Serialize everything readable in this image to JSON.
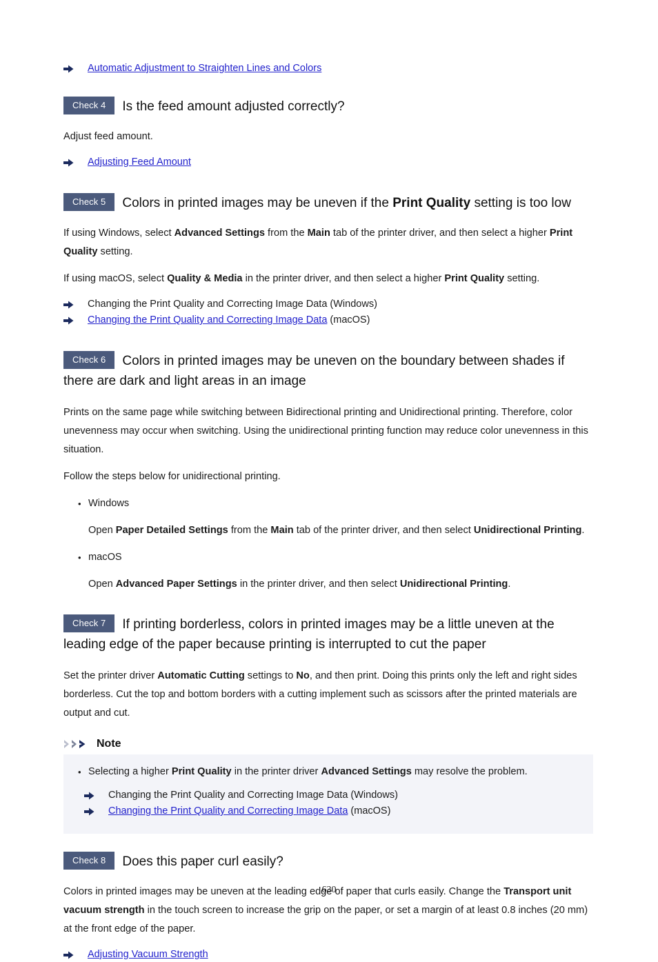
{
  "page": {
    "number": "630",
    "accent_badge_color": "#4b5a7c",
    "link_color": "#2222cc",
    "note_background_color": "#f3f4f9",
    "arrow_icon_color": "#1b2a5e"
  },
  "top_link": {
    "icon": "arrow-right-icon",
    "text": "Automatic Adjustment to Straighten Lines and Colors"
  },
  "check4": {
    "badge": "Check 4",
    "title": "Is the feed amount adjusted correctly?",
    "body": "Adjust feed amount.",
    "link": "Adjusting Feed Amount"
  },
  "check5": {
    "badge": "Check 5",
    "title_pre": "Colors in printed images may be uneven if the ",
    "title_bold": "Print Quality",
    "title_post": " setting is too low",
    "para1": [
      {
        "t": "If using Windows, select ",
        "b": false
      },
      {
        "t": "Advanced Settings",
        "b": true
      },
      {
        "t": " from the ",
        "b": false
      },
      {
        "t": "Main",
        "b": true
      },
      {
        "t": " tab of the printer driver, and then select a higher ",
        "b": false
      },
      {
        "t": "Print Quality",
        "b": true
      },
      {
        "t": " setting.",
        "b": false
      }
    ],
    "para2": [
      {
        "t": "If using macOS, select ",
        "b": false
      },
      {
        "t": "Quality & Media",
        "b": true
      },
      {
        "t": " in the printer driver, and then select a higher ",
        "b": false
      },
      {
        "t": "Print Quality",
        "b": true
      },
      {
        "t": " setting.",
        "b": false
      }
    ],
    "link_windows": "Changing the Print Quality and Correcting Image Data (Windows)",
    "link_macos_text": "Changing the Print Quality and Correcting Image Data",
    "link_macos_suffix": " (macOS)"
  },
  "check6": {
    "badge": "Check 6",
    "title": "Colors in printed images may be uneven on the boundary between shades if there are dark and light areas in an image",
    "para1": "Prints on the same page while switching between Bidirectional printing and Unidirectional printing. Therefore, color unevenness may occur when switching. Using the unidirectional printing function may reduce color unevenness in this situation.",
    "para2": "Follow the steps below for unidirectional printing.",
    "bullet_windows": "Windows",
    "windows_steps": [
      {
        "t": "Open ",
        "b": false
      },
      {
        "t": "Paper Detailed Settings",
        "b": true
      },
      {
        "t": " from the ",
        "b": false
      },
      {
        "t": "Main",
        "b": true
      },
      {
        "t": " tab of the printer driver, and then select ",
        "b": false
      },
      {
        "t": "Unidirectional Printing",
        "b": true
      },
      {
        "t": ".",
        "b": false
      }
    ],
    "bullet_macos": "macOS",
    "macos_steps": [
      {
        "t": "Open ",
        "b": false
      },
      {
        "t": "Advanced Paper Settings",
        "b": true
      },
      {
        "t": " in the printer driver, and then select ",
        "b": false
      },
      {
        "t": "Unidirectional Printing",
        "b": true
      },
      {
        "t": ".",
        "b": false
      }
    ]
  },
  "check7": {
    "badge": "Check 7",
    "title": "If printing borderless, colors in printed images may be a little uneven at the leading edge of the paper because printing is interrupted to cut the paper",
    "para1": [
      {
        "t": "Set the printer driver ",
        "b": false
      },
      {
        "t": "Automatic Cutting",
        "b": true
      },
      {
        "t": " settings to ",
        "b": false
      },
      {
        "t": "No",
        "b": true
      },
      {
        "t": ", and then print. Doing this prints only the left and right sides borderless. Cut the top and bottom borders with a cutting implement such as scissors after the printed materials are output and cut.",
        "b": false
      }
    ]
  },
  "note": {
    "icon": "chevrons-right-icon",
    "label": "Note",
    "bullet": [
      {
        "t": "Selecting a higher ",
        "b": false
      },
      {
        "t": "Print Quality",
        "b": true
      },
      {
        "t": " in the printer driver ",
        "b": false
      },
      {
        "t": "Advanced Settings",
        "b": true
      },
      {
        "t": " may resolve the problem.",
        "b": false
      }
    ],
    "link_windows": "Changing the Print Quality and Correcting Image Data (Windows)",
    "link_macos_text": "Changing the Print Quality and Correcting Image Data",
    "link_macos_suffix": " (macOS)"
  },
  "check8": {
    "badge": "Check 8",
    "title": "Does this paper curl easily?",
    "para1": [
      {
        "t": "Colors in printed images may be uneven at the leading edge of paper that curls easily. Change the ",
        "b": false
      },
      {
        "t": "Transport unit vacuum strength",
        "b": true
      },
      {
        "t": " in the touch screen to increase the grip on the paper, or set a margin of at least 0.8 inches (20 mm) at the front edge of the paper.",
        "b": false
      }
    ],
    "link": "Adjusting Vacuum Strength"
  }
}
